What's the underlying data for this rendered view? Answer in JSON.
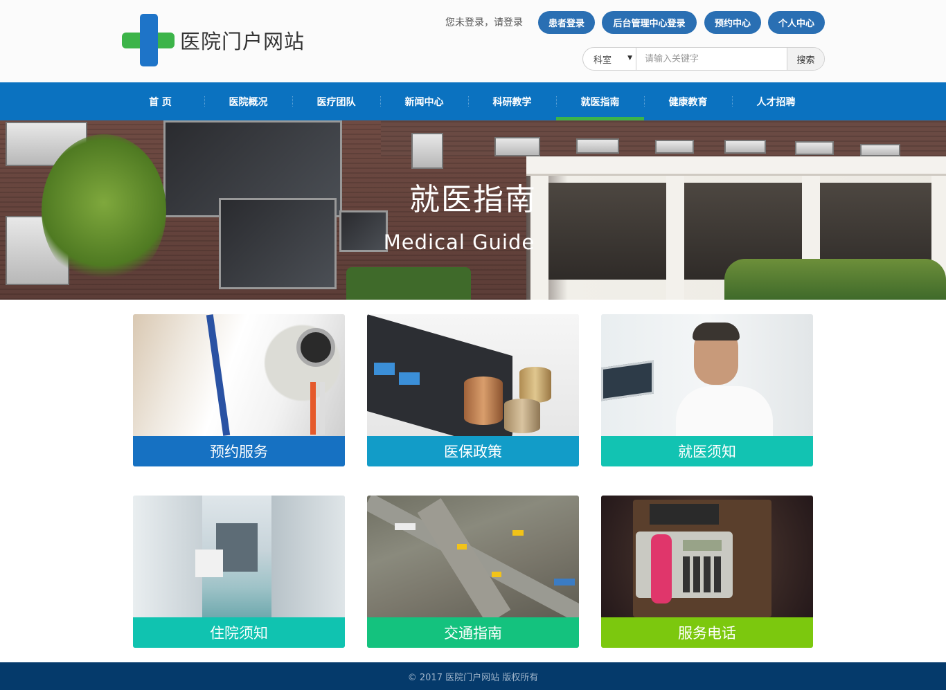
{
  "site": {
    "name": "医院门户网站"
  },
  "user_bar": {
    "status": "您未登录，请登录",
    "buttons": [
      "患者登录",
      "后台管理中心登录",
      "预约中心",
      "个人中心"
    ]
  },
  "search": {
    "category": "科室",
    "placeholder": "请输入关键字",
    "button": "搜索"
  },
  "nav": {
    "items": [
      "首 页",
      "医院概况",
      "医疗团队",
      "新闻中心",
      "科研教学",
      "就医指南",
      "健康教育",
      "人才招聘"
    ],
    "active": "就医指南"
  },
  "banner": {
    "title": "就医指南",
    "subtitle": "Medical Guide"
  },
  "cards": [
    {
      "label": "预约服务",
      "color": "#1671c2"
    },
    {
      "label": "医保政策",
      "color": "#129cc8"
    },
    {
      "label": "就医须知",
      "color": "#12c3b2"
    },
    {
      "label": "住院须知",
      "color": "#10c3b0"
    },
    {
      "label": "交通指南",
      "color": "#14c27e"
    },
    {
      "label": "服务电话",
      "color": "#7cc80e"
    }
  ],
  "footer": {
    "text": "© 2017 医院门户网站 版权所有"
  }
}
